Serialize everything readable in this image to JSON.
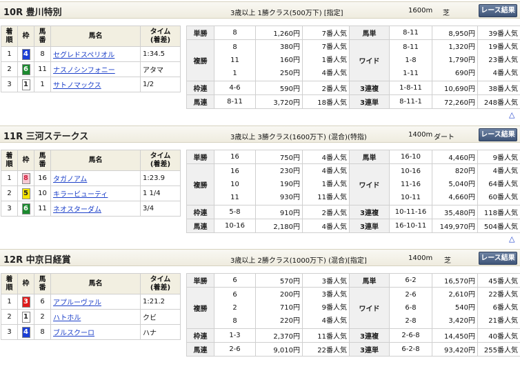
{
  "button_label": "レース結果",
  "top_arrow": "△",
  "col_headers": {
    "rank": "着\n順",
    "waku": "枠",
    "umaban": "馬\n番",
    "horse": "馬名",
    "time": "タイム\n(着差)"
  },
  "bet_labels": {
    "tansho": "単勝",
    "fukusho": "複勝",
    "wakuren": "枠連",
    "umaren": "馬連",
    "umatan": "馬単",
    "wide": "ワイド",
    "sanrenpuku": "3連複",
    "sanrentan": "3連単"
  },
  "races": [
    {
      "title": "10R 豊川特別",
      "cond": "3歳以上 1勝クラス(500万下) [指定]",
      "dist": "1600m",
      "surface": "芝",
      "results": [
        {
          "rank": "1",
          "waku": "4",
          "waku_bg": "#1b3fd6",
          "waku_fg": "#ffffff",
          "num": "8",
          "name": "セグレドスペリオル",
          "time": "1:34.5"
        },
        {
          "rank": "2",
          "waku": "6",
          "waku_bg": "#1c8a2f",
          "waku_fg": "#ffffff",
          "num": "11",
          "name": "ナスノシンフォニー",
          "time": "アタマ"
        },
        {
          "rank": "3",
          "waku": "1",
          "waku_bg": "#ffffff",
          "waku_fg": "#222222",
          "num": "1",
          "name": "サトノマックス",
          "time": "1/2"
        }
      ],
      "tansho": {
        "c": "8",
        "a": "1,260円",
        "p": "7番人気"
      },
      "fukusho": {
        "c": "8\n11\n1",
        "a": "380円\n160円\n250円",
        "p": "7番人気\n1番人気\n4番人気"
      },
      "wakuren": {
        "c": "4-6",
        "a": "590円",
        "p": "2番人気"
      },
      "umaren": {
        "c": "8-11",
        "a": "3,720円",
        "p": "18番人気"
      },
      "umatan": {
        "c": "8-11",
        "a": "8,950円",
        "p": "39番人気"
      },
      "wide": {
        "c": "8-11\n1-8\n1-11",
        "a": "1,320円\n1,790円\n690円",
        "p": "19番人気\n23番人気\n4番人気"
      },
      "sanrenpuku": {
        "c": "1-8-11",
        "a": "10,690円",
        "p": "38番人気"
      },
      "sanrentan": {
        "c": "8-11-1",
        "a": "72,260円",
        "p": "248番人気"
      }
    },
    {
      "title": "11R 三河ステークス",
      "cond": "3歳以上 3勝クラス(1600万下) (混合)(特指)",
      "dist": "1400m",
      "surface": "ダート",
      "results": [
        {
          "rank": "1",
          "waku": "8",
          "waku_bg": "#f6c9d3",
          "waku_fg": "#d11a3a",
          "num": "16",
          "name": "タガノアム",
          "time": "1:23.9"
        },
        {
          "rank": "2",
          "waku": "5",
          "waku_bg": "#f5e400",
          "waku_fg": "#222222",
          "num": "10",
          "name": "キラービューティ",
          "time": "1 1/4"
        },
        {
          "rank": "3",
          "waku": "6",
          "waku_bg": "#1c8a2f",
          "waku_fg": "#ffffff",
          "num": "11",
          "name": "ネオスターダム",
          "time": "3/4"
        }
      ],
      "tansho": {
        "c": "16",
        "a": "750円",
        "p": "4番人気"
      },
      "fukusho": {
        "c": "16\n10\n11",
        "a": "230円\n190円\n930円",
        "p": "4番人気\n1番人気\n11番人気"
      },
      "wakuren": {
        "c": "5-8",
        "a": "910円",
        "p": "2番人気"
      },
      "umaren": {
        "c": "10-16",
        "a": "2,180円",
        "p": "4番人気"
      },
      "umatan": {
        "c": "16-10",
        "a": "4,460円",
        "p": "9番人気"
      },
      "wide": {
        "c": "10-16\n11-16\n10-11",
        "a": "820円\n5,040円\n4,660円",
        "p": "4番人気\n64番人気\n60番人気"
      },
      "sanrenpuku": {
        "c": "10-11-16",
        "a": "35,480円",
        "p": "118番人気"
      },
      "sanrentan": {
        "c": "16-10-11",
        "a": "149,970円",
        "p": "504番人気"
      }
    },
    {
      "title": "12R 中京日経賞",
      "cond": "3歳以上 2勝クラス(1000万下) (混合)[指定]",
      "dist": "1400m",
      "surface": "芝",
      "results": [
        {
          "rank": "1",
          "waku": "3",
          "waku_bg": "#e01b1b",
          "waku_fg": "#ffffff",
          "num": "6",
          "name": "アプルーヴァル",
          "time": "1:21.2"
        },
        {
          "rank": "2",
          "waku": "1",
          "waku_bg": "#ffffff",
          "waku_fg": "#222222",
          "num": "2",
          "name": "ハトホル",
          "time": "クビ"
        },
        {
          "rank": "3",
          "waku": "4",
          "waku_bg": "#1b3fd6",
          "waku_fg": "#ffffff",
          "num": "8",
          "name": "ブルスクーロ",
          "time": "ハナ"
        }
      ],
      "tansho": {
        "c": "6",
        "a": "570円",
        "p": "3番人気"
      },
      "fukusho": {
        "c": "6\n2\n8",
        "a": "200円\n710円\n220円",
        "p": "3番人気\n9番人気\n4番人気"
      },
      "wakuren": {
        "c": "1-3",
        "a": "2,370円",
        "p": "11番人気"
      },
      "umaren": {
        "c": "2-6",
        "a": "9,010円",
        "p": "22番人気"
      },
      "umatan": {
        "c": "6-2",
        "a": "16,570円",
        "p": "45番人気"
      },
      "wide": {
        "c": "2-6\n6-8\n2-8",
        "a": "2,610円\n540円\n3,420円",
        "p": "22番人気\n6番人気\n21番人気"
      },
      "sanrenpuku": {
        "c": "2-6-8",
        "a": "14,450円",
        "p": "40番人気"
      },
      "sanrentan": {
        "c": "6-2-8",
        "a": "93,420円",
        "p": "255番人気"
      }
    }
  ]
}
